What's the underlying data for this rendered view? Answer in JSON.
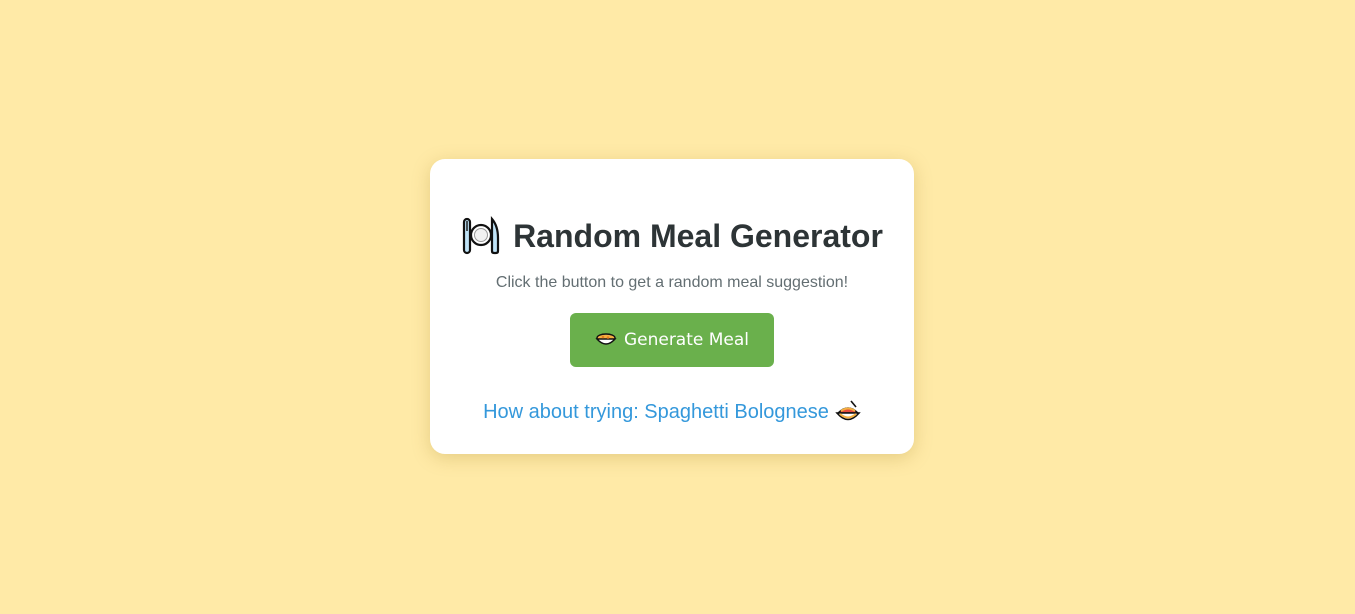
{
  "app": {
    "title": "Random Meal Generator",
    "subtitle": "Click the button to get a random meal suggestion!",
    "title_icon": "plate-with-cutlery-icon"
  },
  "generate_button": {
    "label": "Generate Meal",
    "icon": "bowl-icon"
  },
  "result": {
    "text": "How about trying: Spaghetti Bolognese",
    "icon": "spaghetti-icon"
  },
  "colors": {
    "background": "#ffeaa7",
    "card": "#ffffff",
    "title": "#2d3436",
    "subtitle": "#636e72",
    "button": "#6ab04c",
    "result": "#3498db"
  }
}
